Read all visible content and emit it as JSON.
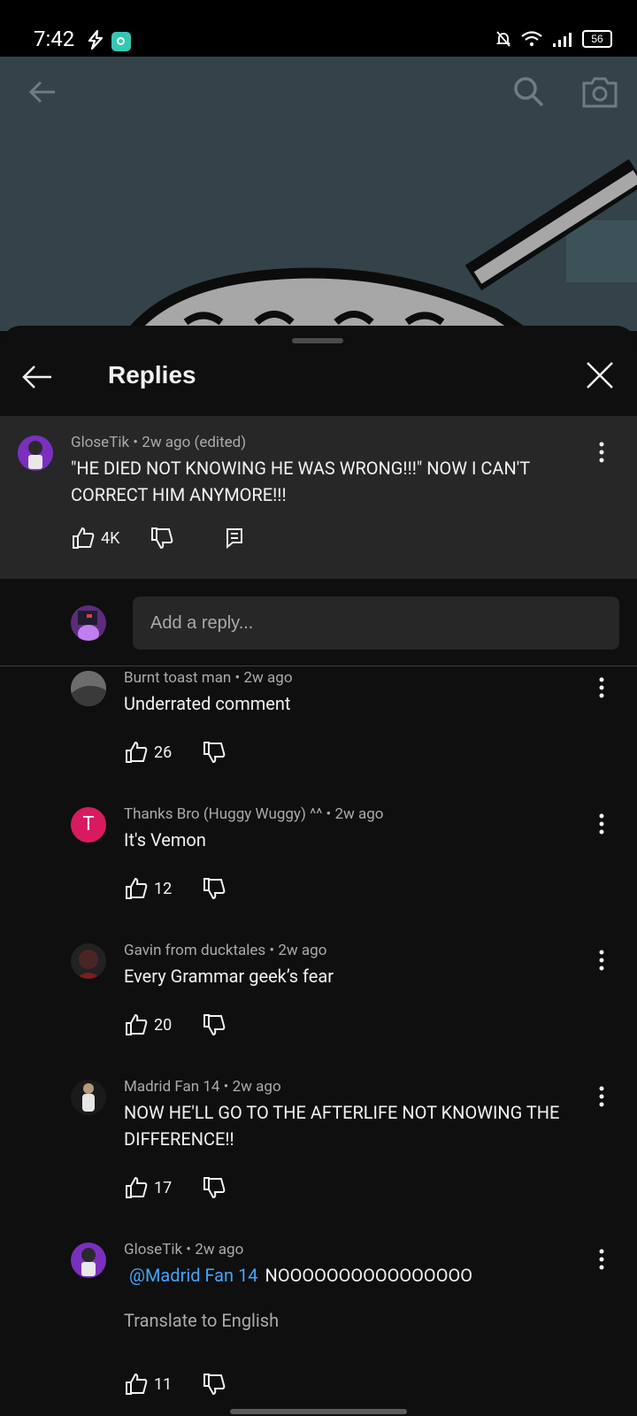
{
  "status": {
    "time": "7:42",
    "battery": "56",
    "icons": [
      "charging-bolt-icon",
      "app-notification-icon",
      "mute-bell-icon",
      "wifi-icon",
      "signal-icon",
      "battery-icon"
    ]
  },
  "video_overlay": {
    "icons": [
      "back-arrow-icon",
      "search-icon",
      "camera-icon"
    ]
  },
  "sheet": {
    "title": "Replies"
  },
  "parent_comment": {
    "author": "GloseTik",
    "meta": "GloseTik • 2w ago (edited)",
    "text": "\"HE DIED NOT KNOWING HE WAS WRONG!!!\" NOW I CAN'T CORRECT HIM ANYMORE!!!",
    "likes": "4K"
  },
  "reply_box": {
    "placeholder": "Add a reply..."
  },
  "replies": [
    {
      "meta": "Burnt toast man • 2w ago",
      "text": "Underrated comment",
      "likes": "26"
    },
    {
      "meta": "Thanks Bro (Huggy Wuggy) ^^ • 2w ago",
      "text": "It's Vemon",
      "likes": "12",
      "avatar_letter": "T"
    },
    {
      "meta": "Gavin from ducktales • 2w ago",
      "text": "Every Grammar geek’s fear",
      "likes": "20"
    },
    {
      "meta": "Madrid Fan 14 • 2w ago",
      "text": "NOW HE'LL GO TO THE AFTERLIFE NOT KNOWING THE DIFFERENCE!!",
      "likes": "17"
    },
    {
      "meta": "GloseTik • 2w ago",
      "mention": "@Madrid Fan 14",
      "text": "NOOOOOOOOOOOOOOOO",
      "translate": "Translate to English",
      "likes": "11"
    }
  ],
  "colors": {
    "background": "#0f0f0f",
    "surface": "#272727",
    "mention_blue": "#3ea6ff",
    "avatar_pink": "#d81b60"
  }
}
